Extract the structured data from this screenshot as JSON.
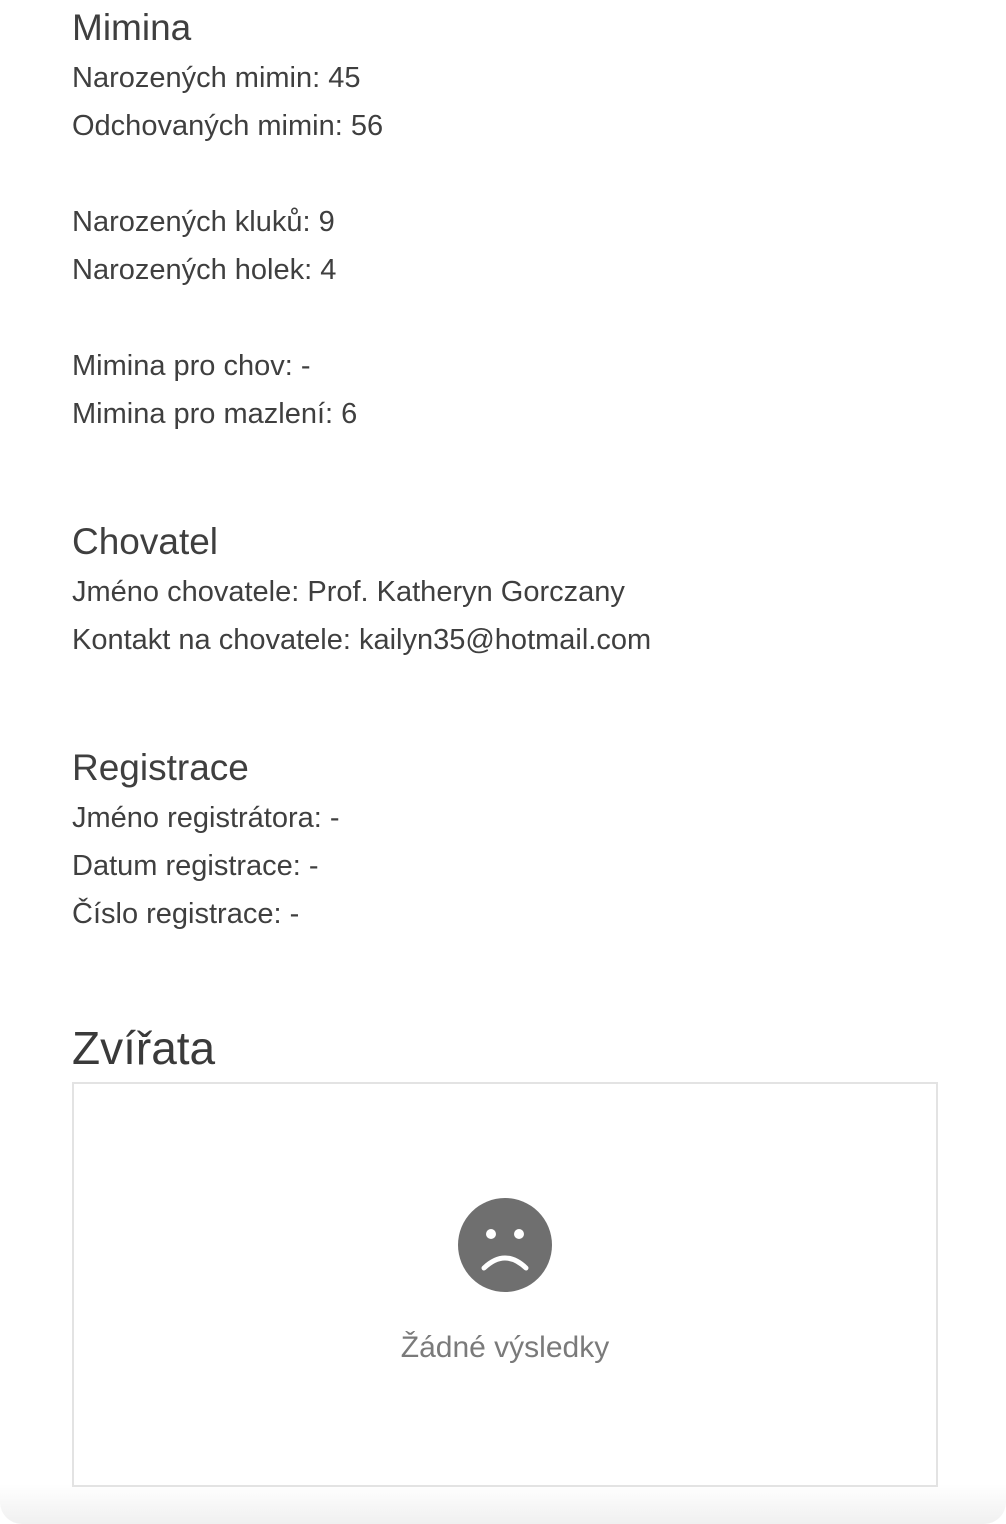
{
  "mimina": {
    "title": "Mimina",
    "born": "Narozených mimin: 45",
    "raised": "Odchovaných mimin: 56",
    "boys": "Narozených kluků: 9",
    "girls": "Narozených holek: 4",
    "breeding": "Mimina pro chov: -",
    "cuddling": "Mimina pro mazlení: 6"
  },
  "chovatel": {
    "title": "Chovatel",
    "name": "Jméno chovatele: Prof. Katheryn Gorczany",
    "contact": "Kontakt na chovatele: kailyn35@hotmail.com"
  },
  "registrace": {
    "title": "Registrace",
    "registrar": "Jméno registrátora: -",
    "date": "Datum registrace: -",
    "number": "Číslo registrace: -"
  },
  "zvirata": {
    "title": "Zvířata",
    "empty_icon": "sad-face-icon",
    "empty_text": "Žádné výsledky"
  },
  "colors": {
    "text": "#3f3f3f",
    "icon": "#6f6f6f",
    "muted": "#7a7a7a",
    "border": "#e3e3e3"
  }
}
